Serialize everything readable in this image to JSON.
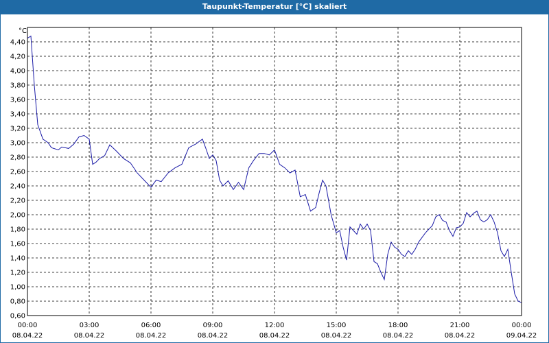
{
  "window": {
    "title": "Taupunkt-Temperatur [°C] skaliert"
  },
  "chart_data": {
    "type": "line",
    "title": "Taupunkt-Temperatur [°C] skaliert",
    "ylabel": "°C",
    "xlabel": "",
    "ylim": [
      0.6,
      4.6
    ],
    "y_ticks": [
      "0,60",
      "0,80",
      "1,00",
      "1,20",
      "1,40",
      "1,60",
      "1,80",
      "2,00",
      "2,20",
      "2,40",
      "2,60",
      "2,80",
      "3,00",
      "3,20",
      "3,40",
      "3,60",
      "3,80",
      "4,00",
      "4,20",
      "4,40"
    ],
    "x_ticks": [
      {
        "time": "00:00",
        "date": "08.04.22"
      },
      {
        "time": "03:00",
        "date": "08.04.22"
      },
      {
        "time": "06:00",
        "date": "08.04.22"
      },
      {
        "time": "09:00",
        "date": "08.04.22"
      },
      {
        "time": "12:00",
        "date": "08.04.22"
      },
      {
        "time": "15:00",
        "date": "08.04.22"
      },
      {
        "time": "18:00",
        "date": "08.04.22"
      },
      {
        "time": "21:00",
        "date": "08.04.22"
      },
      {
        "time": "00:00",
        "date": "09.04.22"
      }
    ],
    "grid": true,
    "line_color": "#1a1aa6",
    "series": [
      {
        "x": [
          "08.04.22 00:00",
          "08.04.22 00:10",
          "08.04.22 00:20",
          "08.04.22 00:30",
          "08.04.22 00:45",
          "08.04.22 01:00",
          "08.04.22 01:10",
          "08.04.22 01:30",
          "08.04.22 01:40",
          "08.04.22 02:00",
          "08.04.22 02:15",
          "08.04.22 02:30",
          "08.04.22 02:45",
          "08.04.22 03:00",
          "08.04.22 03:10",
          "08.04.22 03:20",
          "08.04.22 03:30",
          "08.04.22 03:45",
          "08.04.22 04:00",
          "08.04.22 04:20",
          "08.04.22 04:40",
          "08.04.22 05:00",
          "08.04.22 05:20",
          "08.04.22 05:40",
          "08.04.22 06:00",
          "08.04.22 06:15",
          "08.04.22 06:30",
          "08.04.22 06:50",
          "08.04.22 07:10",
          "08.04.22 07:30",
          "08.04.22 07:50",
          "08.04.22 08:10",
          "08.04.22 08:30",
          "08.04.22 08:40",
          "08.04.22 08:50",
          "08.04.22 09:00",
          "08.04.22 09:10",
          "08.04.22 09:20",
          "08.04.22 09:30",
          "08.04.22 09:45",
          "08.04.22 10:00",
          "08.04.22 10:15",
          "08.04.22 10:30",
          "08.04.22 10:45",
          "08.04.22 11:00",
          "08.04.22 11:15",
          "08.04.22 11:30",
          "08.04.22 11:45",
          "08.04.22 12:00",
          "08.04.22 12:15",
          "08.04.22 12:30",
          "08.04.22 12:45",
          "08.04.22 13:00",
          "08.04.22 13:15",
          "08.04.22 13:30",
          "08.04.22 13:45",
          "08.04.22 14:00",
          "08.04.22 14:10",
          "08.04.22 14:20",
          "08.04.22 14:30",
          "08.04.22 14:45",
          "08.04.22 15:00",
          "08.04.22 15:10",
          "08.04.22 15:20",
          "08.04.22 15:30",
          "08.04.22 15:40",
          "08.04.22 15:50",
          "08.04.22 16:00",
          "08.04.22 16:10",
          "08.04.22 16:20",
          "08.04.22 16:30",
          "08.04.22 16:40",
          "08.04.22 16:50",
          "08.04.22 17:00",
          "08.04.22 17:10",
          "08.04.22 17:20",
          "08.04.22 17:30",
          "08.04.22 17:40",
          "08.04.22 17:50",
          "08.04.22 18:00",
          "08.04.22 18:10",
          "08.04.22 18:20",
          "08.04.22 18:30",
          "08.04.22 18:40",
          "08.04.22 18:50",
          "08.04.22 19:00",
          "08.04.22 19:20",
          "08.04.22 19:40",
          "08.04.22 19:50",
          "08.04.22 20:00",
          "08.04.22 20:10",
          "08.04.22 20:20",
          "08.04.22 20:30",
          "08.04.22 20:40",
          "08.04.22 20:50",
          "08.04.22 21:00",
          "08.04.22 21:10",
          "08.04.22 21:20",
          "08.04.22 21:30",
          "08.04.22 21:40",
          "08.04.22 21:50",
          "08.04.22 22:00",
          "08.04.22 22:10",
          "08.04.22 22:20",
          "08.04.22 22:30",
          "08.04.22 22:40",
          "08.04.22 22:50",
          "08.04.22 23:00",
          "08.04.22 23:10",
          "08.04.22 23:20",
          "08.04.22 23:30",
          "08.04.22 23:40",
          "08.04.22 23:50",
          "09.04.22 00:00"
        ],
        "y": [
          4.45,
          4.48,
          3.8,
          3.25,
          3.05,
          3.0,
          2.93,
          2.9,
          2.94,
          2.92,
          2.98,
          3.08,
          3.1,
          3.05,
          2.7,
          2.73,
          2.78,
          2.82,
          2.97,
          2.88,
          2.78,
          2.72,
          2.58,
          2.48,
          2.38,
          2.48,
          2.46,
          2.58,
          2.65,
          2.7,
          2.93,
          2.98,
          3.05,
          2.92,
          2.78,
          2.83,
          2.75,
          2.48,
          2.4,
          2.47,
          2.35,
          2.45,
          2.35,
          2.65,
          2.76,
          2.85,
          2.85,
          2.83,
          2.9,
          2.7,
          2.65,
          2.58,
          2.62,
          2.25,
          2.28,
          2.05,
          2.1,
          2.3,
          2.48,
          2.4,
          2.0,
          1.75,
          1.78,
          1.55,
          1.37,
          1.83,
          1.78,
          1.73,
          1.87,
          1.8,
          1.87,
          1.78,
          1.35,
          1.32,
          1.2,
          1.1,
          1.45,
          1.62,
          1.55,
          1.52,
          1.45,
          1.42,
          1.5,
          1.45,
          1.52,
          1.62,
          1.75,
          1.85,
          1.97,
          2.0,
          1.92,
          1.9,
          1.78,
          1.7,
          1.82,
          1.83,
          1.88,
          2.03,
          1.97,
          2.02,
          2.05,
          1.93,
          1.9,
          1.93,
          2.0,
          1.9,
          1.75,
          1.5,
          1.42,
          1.52,
          1.2,
          0.9,
          0.8,
          0.78
        ]
      }
    ]
  }
}
